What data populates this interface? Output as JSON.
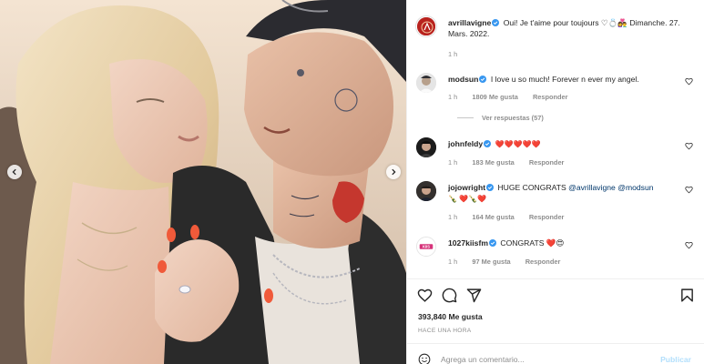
{
  "post": {
    "author": "avrillavigne",
    "caption": "Oui! Je t'aime pour toujours ♡💍👩‍❤️‍👨 Dimanche. 27. Mars. 2022.",
    "caption_age": "1 h",
    "likes": "393,840 Me gusta",
    "time_ago": "HACE UNA HORA"
  },
  "comments": [
    {
      "user": "modsun",
      "text": "I love u so much! Forever n ever my angel.",
      "age": "1 h",
      "likes": "1809 Me gusta",
      "reply": "Responder",
      "view_replies": "Ver respuestas (57)"
    },
    {
      "user": "johnfeldy",
      "text": "❤️❤️❤️❤️❤️",
      "age": "1 h",
      "likes": "183 Me gusta",
      "reply": "Responder"
    },
    {
      "user": "jojowright",
      "text_prefix": "HUGE CONGRATS",
      "mention1": "@avrillavigne",
      "mention2": "@modsun",
      "text_suffix": "🍾 ❤️🍾❤️",
      "age": "1 h",
      "likes": "164 Me gusta",
      "reply": "Responder"
    },
    {
      "user": "1027kiisfm",
      "text": "CONGRATS ❤️😍",
      "age": "1 h",
      "likes": "97 Me gusta",
      "reply": "Responder"
    }
  ],
  "composer": {
    "placeholder": "Agrega un comentario...",
    "publish": "Publicar"
  },
  "icons": {
    "like": "heart-icon",
    "comment": "comment-icon",
    "share": "share-icon",
    "save": "bookmark-icon",
    "emoji": "emoji-icon",
    "verified": "verified-badge-icon",
    "prev": "chevron-left-icon",
    "next": "chevron-right-icon"
  },
  "colors": {
    "verified": "#3897f0",
    "link": "#00376b",
    "muted": "#8e8e8e",
    "publish": "#b2dffc",
    "heart": "#ed4956"
  }
}
